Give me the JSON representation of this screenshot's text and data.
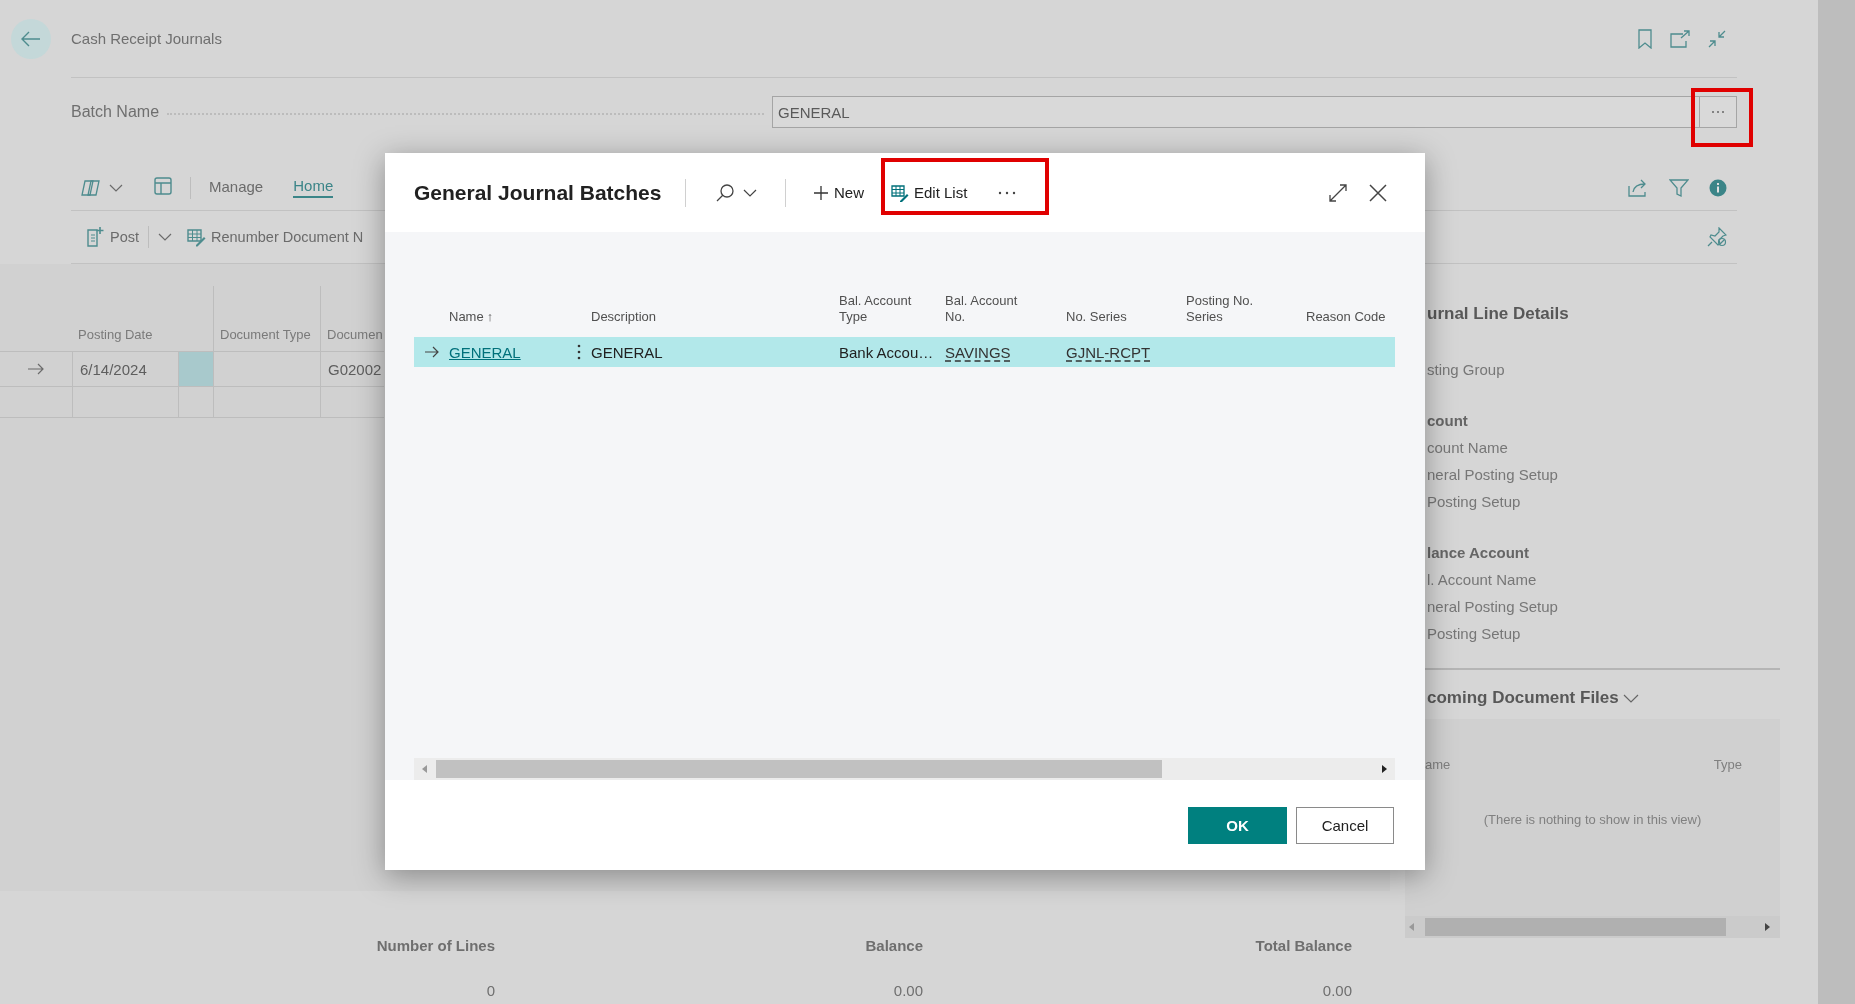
{
  "page": {
    "title": "Cash Receipt Journals",
    "batch_name": {
      "label": "Batch Name",
      "value": "GENERAL"
    },
    "action_tabs": [
      {
        "label": "Manage",
        "selected": false
      },
      {
        "label": "Home",
        "selected": true
      }
    ],
    "actions": [
      {
        "label": "Post"
      },
      {
        "label": "Renumber Document N"
      }
    ],
    "lines": {
      "columns": [
        "Posting Date",
        "Document Type",
        "Documen"
      ],
      "rows": [
        {
          "posting_date": "6/14/2024",
          "document_no": "G02002",
          "current": true
        }
      ]
    },
    "totals": [
      {
        "label": "Number of Lines",
        "value": "0"
      },
      {
        "label": "Balance",
        "value": "0.00"
      },
      {
        "label": "Total Balance",
        "value": "0.00"
      }
    ]
  },
  "factbox": {
    "title": "urnal Line Details",
    "items": [
      {
        "kind": "field",
        "text": "sting Group"
      },
      {
        "kind": "heading",
        "text": "count"
      },
      {
        "kind": "field",
        "text": "count Name"
      },
      {
        "kind": "field",
        "text": "neral Posting Setup"
      },
      {
        "kind": "field",
        "text": "Posting Setup"
      },
      {
        "kind": "heading",
        "text": "lance Account"
      },
      {
        "kind": "field",
        "text": "l. Account Name"
      },
      {
        "kind": "field",
        "text": "neral Posting Setup"
      },
      {
        "kind": "field",
        "text": "Posting Setup"
      }
    ],
    "incoming": {
      "title": "coming Document Files",
      "columns": [
        "ame",
        "Type"
      ],
      "empty_text": "(There is nothing to show in this view)"
    }
  },
  "dialog": {
    "title": "General Journal Batches",
    "actions": [
      {
        "label": "New"
      },
      {
        "label": "Edit List"
      }
    ],
    "columns": [
      {
        "label": "Name",
        "sort_mark": "↑"
      },
      {
        "label": "Description"
      },
      {
        "label": "Bal. Account Type"
      },
      {
        "label": "Bal. Account No."
      },
      {
        "label": "No. Series"
      },
      {
        "label": "Posting No. Series"
      },
      {
        "label": "Reason Code"
      }
    ],
    "rows": [
      {
        "name": "GENERAL",
        "description": "GENERAL",
        "bal_account_type": "Bank Accou…",
        "bal_account_no": "SAVINGS",
        "no_series": "GJNL-RCPT",
        "selected": true
      }
    ],
    "buttons": [
      {
        "label": "OK",
        "kind": "primary"
      },
      {
        "label": "Cancel",
        "kind": "secondary"
      }
    ]
  }
}
